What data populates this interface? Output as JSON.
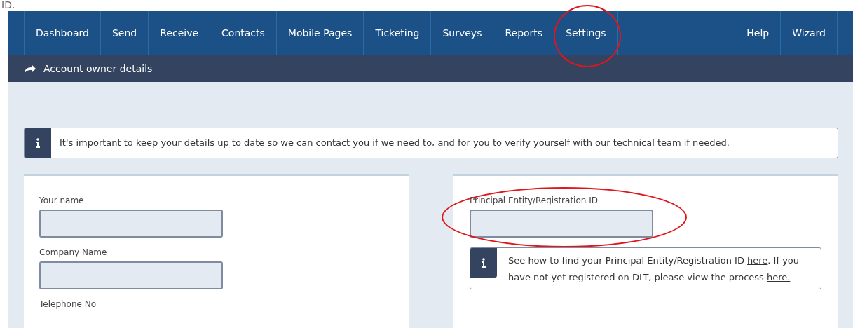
{
  "caption": "ID.",
  "nav": {
    "items": [
      {
        "label": "Dashboard",
        "highlighted": false
      },
      {
        "label": "Send",
        "highlighted": false
      },
      {
        "label": "Receive",
        "highlighted": false
      },
      {
        "label": "Contacts",
        "highlighted": false
      },
      {
        "label": "Mobile Pages",
        "highlighted": false
      },
      {
        "label": "Ticketing",
        "highlighted": false
      },
      {
        "label": "Surveys",
        "highlighted": false
      },
      {
        "label": "Reports",
        "highlighted": false
      },
      {
        "label": "Settings",
        "highlighted": true
      }
    ],
    "right_items": [
      {
        "label": "Help",
        "highlighted": false
      },
      {
        "label": "Wizard",
        "highlighted": false
      }
    ]
  },
  "breadcrumb": {
    "label": "Account owner details"
  },
  "notice": {
    "text": "It's important to keep your details up to date so we can contact you if we need to, and for you to verify yourself with our technical team if needed."
  },
  "left_panel": {
    "fields": [
      {
        "label": "Your name",
        "highlighted": false
      },
      {
        "label": "Company Name",
        "highlighted": false
      }
    ],
    "cut_label": "Telephone No"
  },
  "right_panel": {
    "fields": [
      {
        "label": "Principal Entity/Registration ID",
        "highlighted": true
      }
    ],
    "help_note": [
      {
        "kind": "text",
        "text": "See how to find your Principal Entity/Registration ID "
      },
      {
        "kind": "link",
        "text": "here"
      },
      {
        "kind": "text",
        "text": ". If you have not yet registered on DLT, please view the process "
      },
      {
        "kind": "link",
        "text": "here."
      }
    ]
  }
}
